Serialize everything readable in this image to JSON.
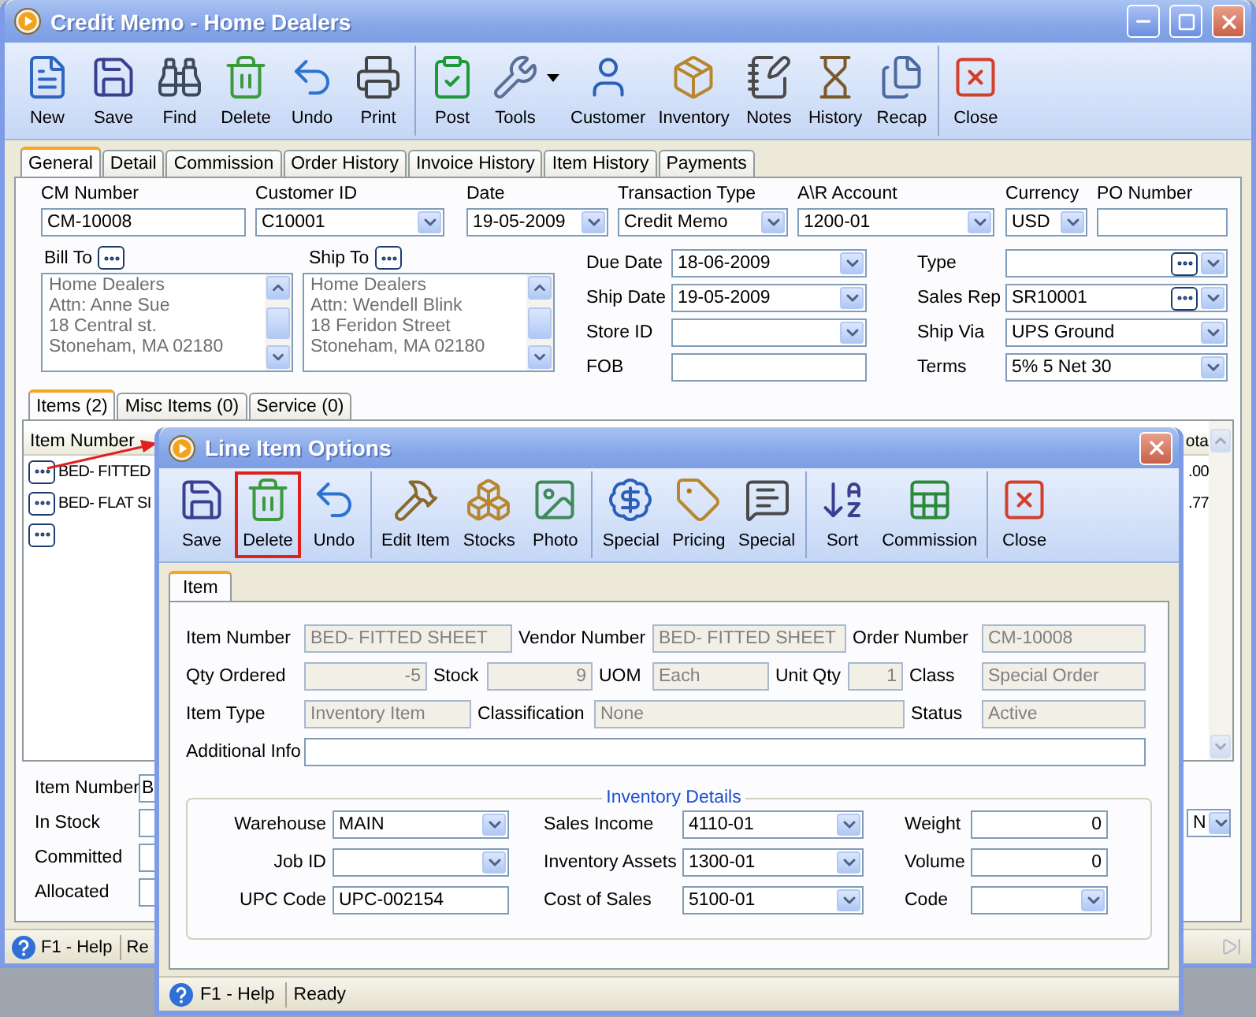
{
  "window": {
    "title": "Credit Memo - Home Dealers"
  },
  "toolbar": [
    [
      {
        "label": "New",
        "kind": "new",
        "has_menu": false
      },
      {
        "label": "Save",
        "kind": "save",
        "has_menu": false
      },
      {
        "label": "Find",
        "kind": "find",
        "has_menu": false
      },
      {
        "label": "Delete",
        "kind": "delete",
        "has_menu": false
      },
      {
        "label": "Undo",
        "kind": "undo",
        "has_menu": false
      },
      {
        "label": "Print",
        "kind": "print",
        "has_menu": false
      }
    ],
    [
      {
        "label": "Post",
        "kind": "post",
        "has_menu": false
      },
      {
        "label": "Tools",
        "kind": "tools",
        "has_menu": true
      },
      {
        "label": "Customer",
        "kind": "customer",
        "has_menu": false
      },
      {
        "label": "Inventory",
        "kind": "inventory",
        "has_menu": false
      },
      {
        "label": "Notes",
        "kind": "notes",
        "has_menu": false
      },
      {
        "label": "History",
        "kind": "history",
        "has_menu": false
      },
      {
        "label": "Recap",
        "kind": "recap",
        "has_menu": false
      }
    ],
    [
      {
        "label": "Close",
        "kind": "close",
        "has_menu": false
      }
    ]
  ],
  "tabs": [
    {
      "label": "General",
      "selected": true
    },
    {
      "label": "Detail",
      "selected": false
    },
    {
      "label": "Commission",
      "selected": false
    },
    {
      "label": "Order History",
      "selected": false
    },
    {
      "label": "Invoice History",
      "selected": false
    },
    {
      "label": "Item History",
      "selected": false
    },
    {
      "label": "Payments",
      "selected": false
    }
  ],
  "header_fields": [
    {
      "label": "CM Number",
      "value": "CM-10008",
      "kind": "text"
    },
    {
      "label": "Customer ID",
      "value": "C10001",
      "kind": "combo"
    },
    {
      "label": "Date",
      "value": "19-05-2009",
      "kind": "combo"
    },
    {
      "label": "Transaction Type",
      "value": "Credit Memo",
      "kind": "combo"
    },
    {
      "label": "A\\R Account",
      "value": "1200-01",
      "kind": "combo"
    },
    {
      "label": "Currency",
      "value": "USD",
      "kind": "combo"
    },
    {
      "label": "PO Number",
      "kind": "text"
    }
  ],
  "addresses": [
    {
      "label": "Bill To",
      "lines": [
        "Home Dealers",
        "Attn: Anne Sue",
        "18 Central st.",
        "Stoneham, MA 02180"
      ]
    },
    {
      "label": "Ship To",
      "lines": [
        "Home Dealers",
        "Attn: Wendell Blink",
        "18 Feridon Street",
        "Stoneham, MA 02180"
      ]
    }
  ],
  "date_fields": [
    {
      "label": "Due Date",
      "value": "18-06-2009",
      "kind": "combo"
    },
    {
      "label": "Ship Date",
      "value": "19-05-2009",
      "kind": "combo"
    },
    {
      "label": "Store ID",
      "kind": "combo"
    },
    {
      "label": "FOB",
      "kind": "text"
    }
  ],
  "order_fields": [
    {
      "label": "Type",
      "kind": "lookup"
    },
    {
      "label": "Sales Rep",
      "value": "SR10001",
      "kind": "lookup"
    },
    {
      "label": "Ship Via",
      "value": "UPS Ground",
      "kind": "combo"
    },
    {
      "label": "Terms",
      "value": "5% 5 Net 30",
      "kind": "combo"
    }
  ],
  "item_tabs": [
    {
      "label": "Items (2)",
      "selected": true
    },
    {
      "label": "Misc Items (0)",
      "selected": false
    },
    {
      "label": "Service (0)",
      "selected": false
    }
  ],
  "grid": {
    "columns": [
      "Item Number",
      "ota"
    ],
    "rows": [
      {
        "kind": "item",
        "item_number": "BED- FITTED",
        "total": ".00"
      },
      {
        "kind": "item",
        "item_number": "BED- FLAT SI",
        "total": ".77"
      },
      {
        "kind": "new"
      }
    ]
  },
  "bottom_fields": [
    {
      "label": "Item Number",
      "value": "B"
    },
    {
      "label": "In Stock"
    },
    {
      "label": "Committed"
    },
    {
      "label": "Allocated"
    }
  ],
  "bottom_combo": {
    "value": "N"
  },
  "status_bar": {
    "help": "F1 - Help",
    "message": "Re"
  },
  "dialog": {
    "title": "Line Item Options",
    "toolbar": [
      [
        {
          "label": "Save",
          "kind": "save",
          "highlighted": false
        },
        {
          "label": "Delete",
          "kind": "delete",
          "highlighted": true
        },
        {
          "label": "Undo",
          "kind": "undo",
          "highlighted": false
        }
      ],
      [
        {
          "label": "Edit Item",
          "kind": "edit_item",
          "highlighted": false
        },
        {
          "label": "Stocks",
          "kind": "stocks",
          "highlighted": false
        },
        {
          "label": "Photo",
          "kind": "photo",
          "highlighted": false
        }
      ],
      [
        {
          "label": "Special",
          "kind": "special",
          "highlighted": false
        },
        {
          "label": "Pricing",
          "kind": "pricing",
          "highlighted": false
        },
        {
          "label": "Special",
          "kind": "special_quote",
          "highlighted": false
        }
      ],
      [
        {
          "label": "Sort",
          "kind": "sort",
          "highlighted": false
        },
        {
          "label": "Commission",
          "kind": "commission",
          "highlighted": false
        }
      ],
      [
        {
          "label": "Close",
          "kind": "close",
          "highlighted": false
        }
      ]
    ],
    "tabs": [
      {
        "label": "Item",
        "selected": true
      }
    ],
    "rows": [
      [
        {
          "label": "Item Number",
          "value": "BED- FITTED SHEET",
          "kind": "readonly"
        },
        {
          "label": "Vendor Number",
          "value": "BED- FITTED SHEET",
          "kind": "readonly"
        },
        {
          "label": "Order Number",
          "value": "CM-10008",
          "kind": "readonly"
        }
      ],
      [
        {
          "label": "Qty Ordered",
          "value": "-5",
          "kind": "readonly_number"
        },
        {
          "label": "Stock",
          "value": "9",
          "kind": "readonly_number"
        },
        {
          "label": "UOM",
          "value": "Each",
          "kind": "readonly"
        },
        {
          "label": "Unit Qty",
          "value": "1",
          "kind": "readonly_number"
        },
        {
          "label": "Class",
          "value": "Special Order",
          "kind": "readonly"
        }
      ],
      [
        {
          "label": "Item Type",
          "value": "Inventory Item",
          "kind": "readonly"
        },
        {
          "label": "Classification",
          "value": "None",
          "kind": "readonly"
        },
        {
          "label": "Status",
          "value": "Active",
          "kind": "readonly"
        }
      ],
      [
        {
          "label": "Additional Info",
          "kind": "text"
        }
      ]
    ],
    "inventory_details": {
      "title": "Inventory Details",
      "rows": [
        [
          {
            "label": "Warehouse",
            "value": "MAIN",
            "kind": "combo"
          },
          {
            "label": "Sales Income",
            "value": "4110-01",
            "kind": "combo"
          },
          {
            "label": "Weight",
            "value": "0",
            "kind": "number"
          }
        ],
        [
          {
            "label": "Job ID",
            "kind": "combo"
          },
          {
            "label": "Inventory Assets",
            "value": "1300-01",
            "kind": "combo"
          },
          {
            "label": "Volume",
            "value": "0",
            "kind": "number"
          }
        ],
        [
          {
            "label": "UPC Code",
            "value": "UPC-002154",
            "kind": "text"
          },
          {
            "label": "Cost of Sales",
            "value": "5100-01",
            "kind": "combo"
          },
          {
            "label": "Code",
            "kind": "combo"
          }
        ]
      ]
    },
    "status_bar": {
      "help": "F1 - Help",
      "message": "Ready"
    }
  }
}
